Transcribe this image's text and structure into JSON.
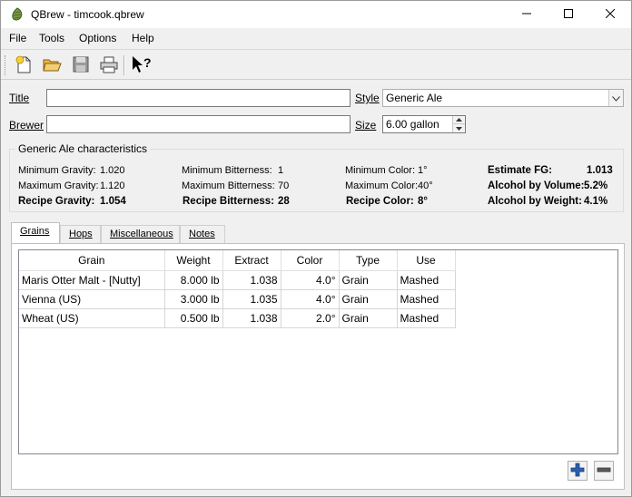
{
  "window": {
    "title": "QBrew - timcook.qbrew"
  },
  "menu": [
    "File",
    "Tools",
    "Options",
    "Help"
  ],
  "toolbar": {
    "buttons": [
      {
        "icon": "new-file-icon"
      },
      {
        "icon": "open-folder-icon"
      },
      {
        "icon": "save-disk-icon"
      },
      {
        "icon": "printer-icon"
      },
      {
        "icon": "whats-this-help-icon"
      }
    ]
  },
  "form": {
    "title_label": "Title",
    "title_value": "",
    "brewer_label": "Brewer",
    "brewer_value": "",
    "style_label": "Style",
    "style_value": "Generic Ale",
    "size_label": "Size",
    "size_value": "6.00 gallon"
  },
  "characteristics": {
    "group_title": "Generic Ale characteristics",
    "min_gravity_label": "Minimum Gravity:",
    "min_gravity": "1.020",
    "max_gravity_label": "Maximum Gravity:",
    "max_gravity": "1.120",
    "recipe_gravity_label": "Recipe Gravity:",
    "recipe_gravity": "1.054",
    "min_bitterness_label": "Minimum Bitterness:",
    "min_bitterness": "1",
    "max_bitterness_label": "Maximum Bitterness:",
    "max_bitterness": "70",
    "recipe_bitterness_label": "Recipe Bitterness:",
    "recipe_bitterness": "28",
    "min_color_label": "Minimum Color:",
    "min_color": "1°",
    "max_color_label": "Maximum Color:",
    "max_color": "40°",
    "recipe_color_label": "Recipe Color:",
    "recipe_color": "8°",
    "fg_label": "Estimate FG:",
    "fg": "1.013",
    "abv_label": "Alcohol by Volume:",
    "abv": "5.2%",
    "abw_label": "Alcohol by Weight:",
    "abw": "4.1%"
  },
  "tabs": [
    {
      "label": "Grains",
      "active": true
    },
    {
      "label": "Hops",
      "active": false
    },
    {
      "label": "Miscellaneous",
      "active": false
    },
    {
      "label": "Notes",
      "active": false
    }
  ],
  "grains_table": {
    "columns": [
      "Grain",
      "Weight",
      "Extract",
      "Color",
      "Type",
      "Use"
    ],
    "rows": [
      [
        "Maris Otter Malt - [Nutty]",
        "8.000 lb",
        "1.038",
        "4.0°",
        "Grain",
        "Mashed"
      ],
      [
        "Vienna (US)",
        "3.000 lb",
        "1.035",
        "4.0°",
        "Grain",
        "Mashed"
      ],
      [
        "Wheat (US)",
        "0.500 lb",
        "1.038",
        "2.0°",
        "Grain",
        "Mashed"
      ]
    ]
  },
  "colors": {
    "accent_blue": "#2a5fb0",
    "window_bg": "#f0f0f0",
    "hop_green": "#6a8f3a"
  }
}
